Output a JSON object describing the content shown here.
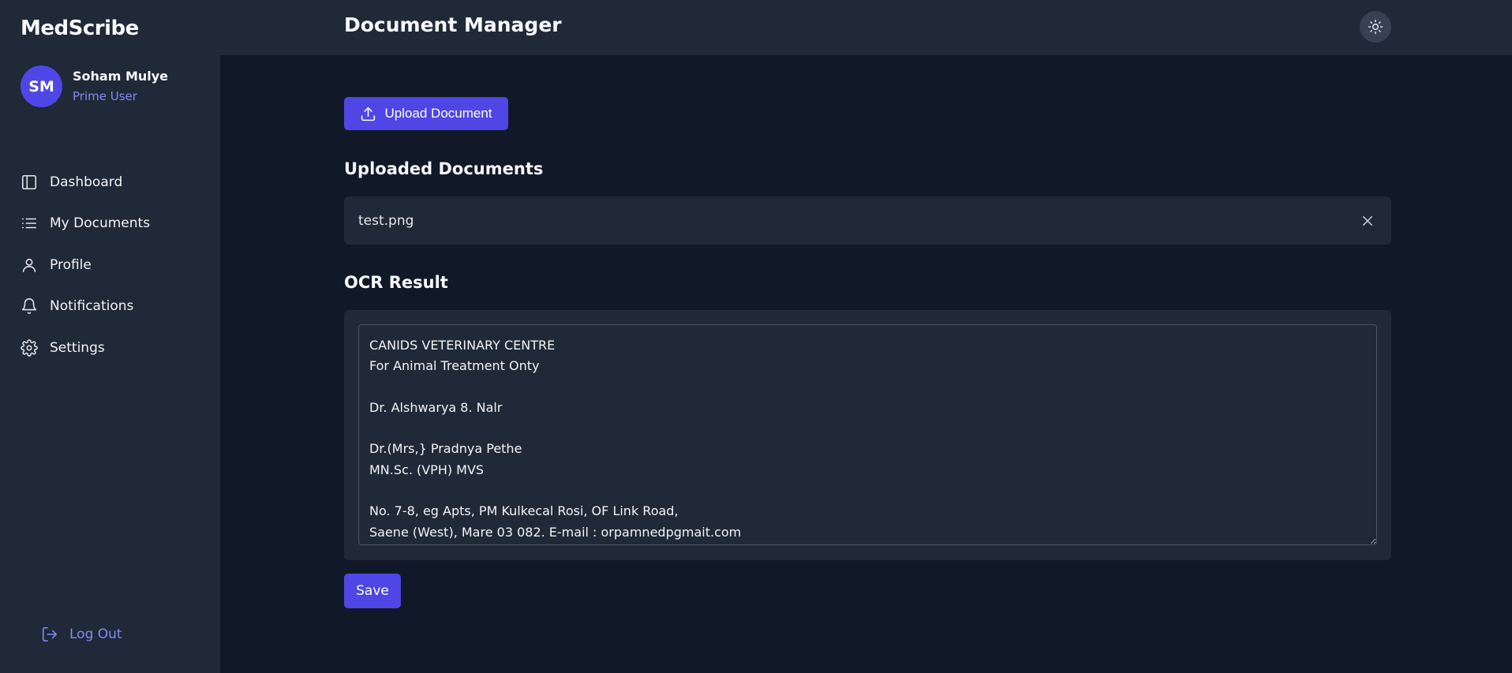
{
  "app": {
    "brand": "MedScribe"
  },
  "user": {
    "initials": "SM",
    "name": "Soham Mulye",
    "role": "Prime User"
  },
  "sidebar": {
    "items": [
      {
        "label": "Dashboard",
        "icon": "layout-icon"
      },
      {
        "label": "My Documents",
        "icon": "list-icon"
      },
      {
        "label": "Profile",
        "icon": "user-icon"
      },
      {
        "label": "Notifications",
        "icon": "bell-icon"
      },
      {
        "label": "Settings",
        "icon": "gear-icon"
      }
    ],
    "logout_label": "Log Out"
  },
  "header": {
    "title": "Document Manager",
    "theme_toggle_icon": "sun-icon"
  },
  "main": {
    "upload_label": "Upload Document",
    "uploaded_title": "Uploaded Documents",
    "documents": [
      {
        "name": "test.png"
      }
    ],
    "ocr_title": "OCR Result",
    "ocr_text": "CANIDS VETERINARY CENTRE\nFor Animal Treatment Onty\n\nDr. Alshwarya 8. Nalr\n\nDr.(Mrs,} Pradnya Pethe\nMN.Sc. (VPH) MVS\n\nNo. 7-8, eg Apts, PM Kulkecal Rosi, OF Link Road,\nSaene (West), Mare 03 082. E-mail : orpamnedpgmait.com",
    "save_label": "Save"
  },
  "colors": {
    "accent": "#4f46e5",
    "accent_text": "#818cf8",
    "background": "#111827",
    "panel": "#1f2937"
  }
}
